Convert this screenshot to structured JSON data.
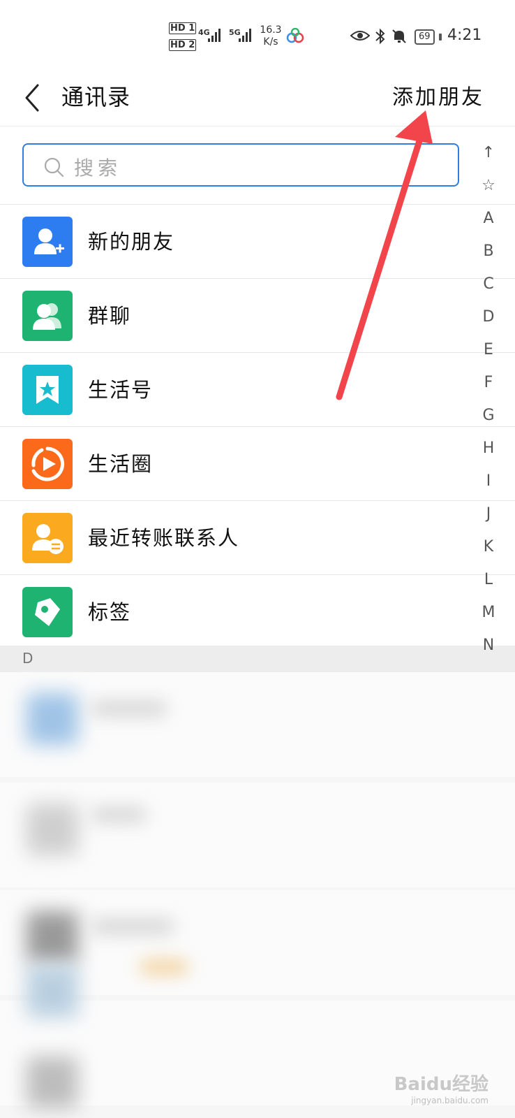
{
  "status_bar": {
    "sim1": "HD 1",
    "sim2": "HD 2",
    "net1": "4G",
    "net2": "5G",
    "speed_value": "16.3",
    "speed_unit": "K/s",
    "battery": "69",
    "time": "4:21"
  },
  "header": {
    "title": "通讯录",
    "add_friend": "添加朋友"
  },
  "search": {
    "placeholder": "搜索"
  },
  "menu": [
    {
      "label": "新的朋友",
      "color": "#2d7cf0",
      "icon": "add-user-icon"
    },
    {
      "label": "群聊",
      "color": "#1fb372",
      "icon": "group-icon"
    },
    {
      "label": "生活号",
      "color": "#17bccf",
      "icon": "star-bookmark-icon"
    },
    {
      "label": "生活圈",
      "color": "#fb6a1b",
      "icon": "play-circle-icon"
    },
    {
      "label": "最近转账联系人",
      "color": "#fba91f",
      "icon": "transfer-contact-icon"
    },
    {
      "label": "标签",
      "color": "#1fb372",
      "icon": "tag-icon"
    }
  ],
  "section": {
    "letter": "D"
  },
  "index_bar": [
    "↑",
    "☆",
    "A",
    "B",
    "C",
    "D",
    "E",
    "F",
    "G",
    "H",
    "I",
    "J",
    "K",
    "L",
    "M",
    "N"
  ],
  "annotation": {
    "arrow_color": "#f2444b"
  },
  "watermark": {
    "brand": "Baidu经验",
    "sub": "jingyan.baidu.com"
  }
}
